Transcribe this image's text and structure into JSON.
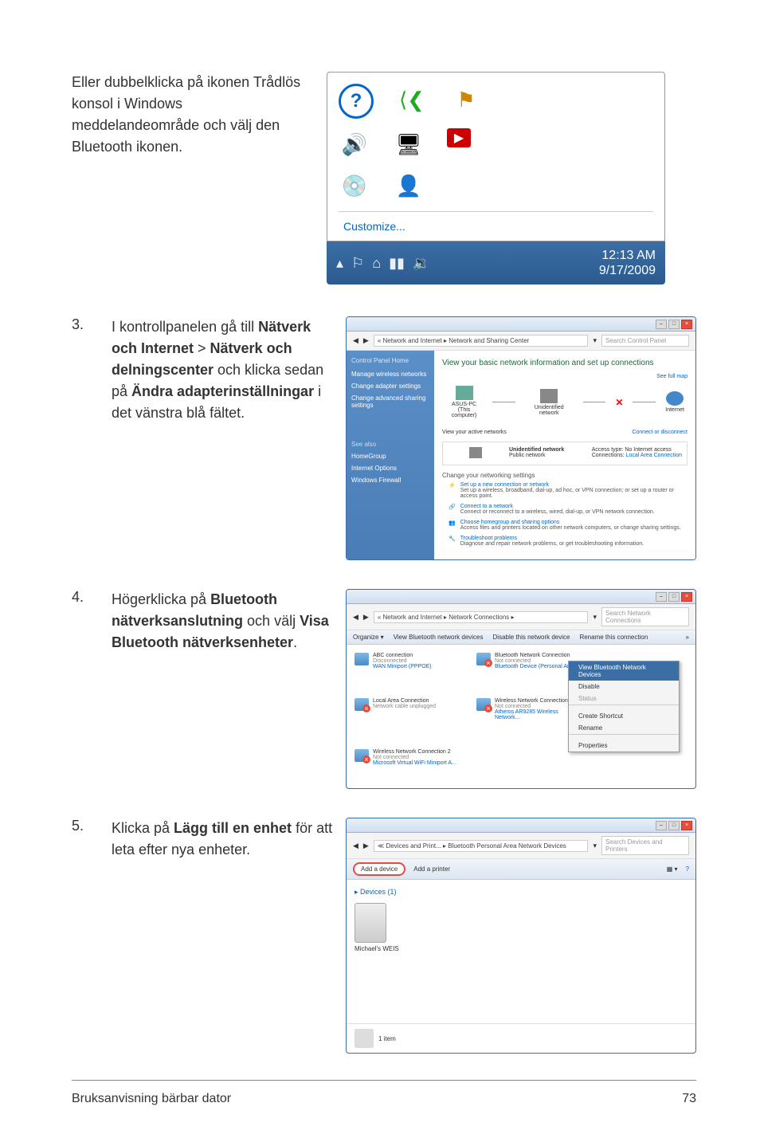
{
  "topText": "Eller dubbelklicka på ikonen Trådlös konsol i Windows meddelandeområde och välj den Bluetooth ikonen.",
  "tray": {
    "customize": "Customize...",
    "time": "12:13 AM",
    "date": "9/17/2009"
  },
  "steps": {
    "s3": {
      "num": "3.",
      "pre": "I kontrollpanelen gå till ",
      "b1": "Nätverk och Internet",
      "gt": " > ",
      "b2": "Nätverk och delningscenter",
      "mid": " och klicka sedan på ",
      "b3": "Ändra adapterinställningar",
      "post": " i det vänstra blå fältet."
    },
    "s4": {
      "num": "4.",
      "pre": "Högerklicka på ",
      "b1": "Bluetooth nätverksanslutning",
      "mid": " och välj ",
      "b2": "Visa Bluetooth nätverksenheter",
      "post": "."
    },
    "s5": {
      "num": "5.",
      "pre": "Klicka på ",
      "b1": "Lägg till en enhet",
      "post": " för att leta efter nya enheter."
    }
  },
  "ns": {
    "addr": "« Network and Internet ▸ Network and Sharing Center",
    "search": "Search Control Panel",
    "leftHome": "Control Panel Home",
    "leftItems": [
      "Manage wireless networks",
      "Change adapter settings",
      "Change advanced sharing settings"
    ],
    "leftSee": "See also",
    "leftSeeItems": [
      "HomeGroup",
      "Internet Options",
      "Windows Firewall"
    ],
    "heading": "View your basic network information and set up connections",
    "fullmap": "See full map",
    "nodes": {
      "pc": "ASUS-PC",
      "pcSub": "(This computer)",
      "net": "Unidentified network",
      "inet": "Internet"
    },
    "viewActive": "View your active networks",
    "connDisc": "Connect or disconnect",
    "activeNet": "Unidentified network",
    "activeType": "Public network",
    "accessLbl": "Access type:",
    "accessVal": "No Internet access",
    "connLbl": "Connections:",
    "connVal": "Local Area Connection",
    "changeSettings": "Change your networking settings",
    "items": [
      {
        "t": "Set up a new connection or network",
        "d": "Set up a wireless, broadband, dial-up, ad hoc, or VPN connection; or set up a router or access point."
      },
      {
        "t": "Connect to a network",
        "d": "Connect or reconnect to a wireless, wired, dial-up, or VPN network connection."
      },
      {
        "t": "Choose homegroup and sharing options",
        "d": "Access files and printers located on other network computers, or change sharing settings."
      },
      {
        "t": "Troubleshoot problems",
        "d": "Diagnose and repair network problems, or get troubleshooting information."
      }
    ]
  },
  "nc": {
    "addr": "« Network and Internet ▸ Network Connections ▸",
    "search": "Search Network Connections",
    "toolbar": [
      "Organize ▾",
      "View Bluetooth network devices",
      "Disable this network device",
      "Rename this connection",
      "»"
    ],
    "items": [
      {
        "n": "ABC connection",
        "s": "Disconnected",
        "d": "WAN Miniport (PPPOE)",
        "x": false
      },
      {
        "n": "Bluetooth Network Connection",
        "s": "Not connected",
        "d": "Bluetooth Device (Personal Area...",
        "x": true
      },
      {
        "n": "Local Area Connection",
        "s": "Network cable unplugged",
        "d": "",
        "x": true
      },
      {
        "n": "Wireless Network Connection",
        "s": "Not connected",
        "d": "Atheros AR9285 Wireless Network...",
        "x": true
      },
      {
        "n": "Wireless Network Connection 2",
        "s": "Not connected",
        "d": "Microsoft Virtual WiFi Miniport A...",
        "x": true
      }
    ],
    "ctx": [
      "View Bluetooth Network Devices",
      "Disable",
      "Status",
      "Create Shortcut",
      "Rename",
      "Properties"
    ],
    "ctxHl": 0
  },
  "dp": {
    "addr": "≪ Devices and Print... ▸ Bluetooth Personal Area Network Devices",
    "search": "Search Devices and Printers",
    "add": "Add a device",
    "addP": "Add a printer",
    "cat": "▸ Devices (1)",
    "dev": "Michael's WEIS",
    "footer": "1 item"
  },
  "footer": {
    "left": "Bruksanvisning bärbar dator",
    "right": "73"
  }
}
